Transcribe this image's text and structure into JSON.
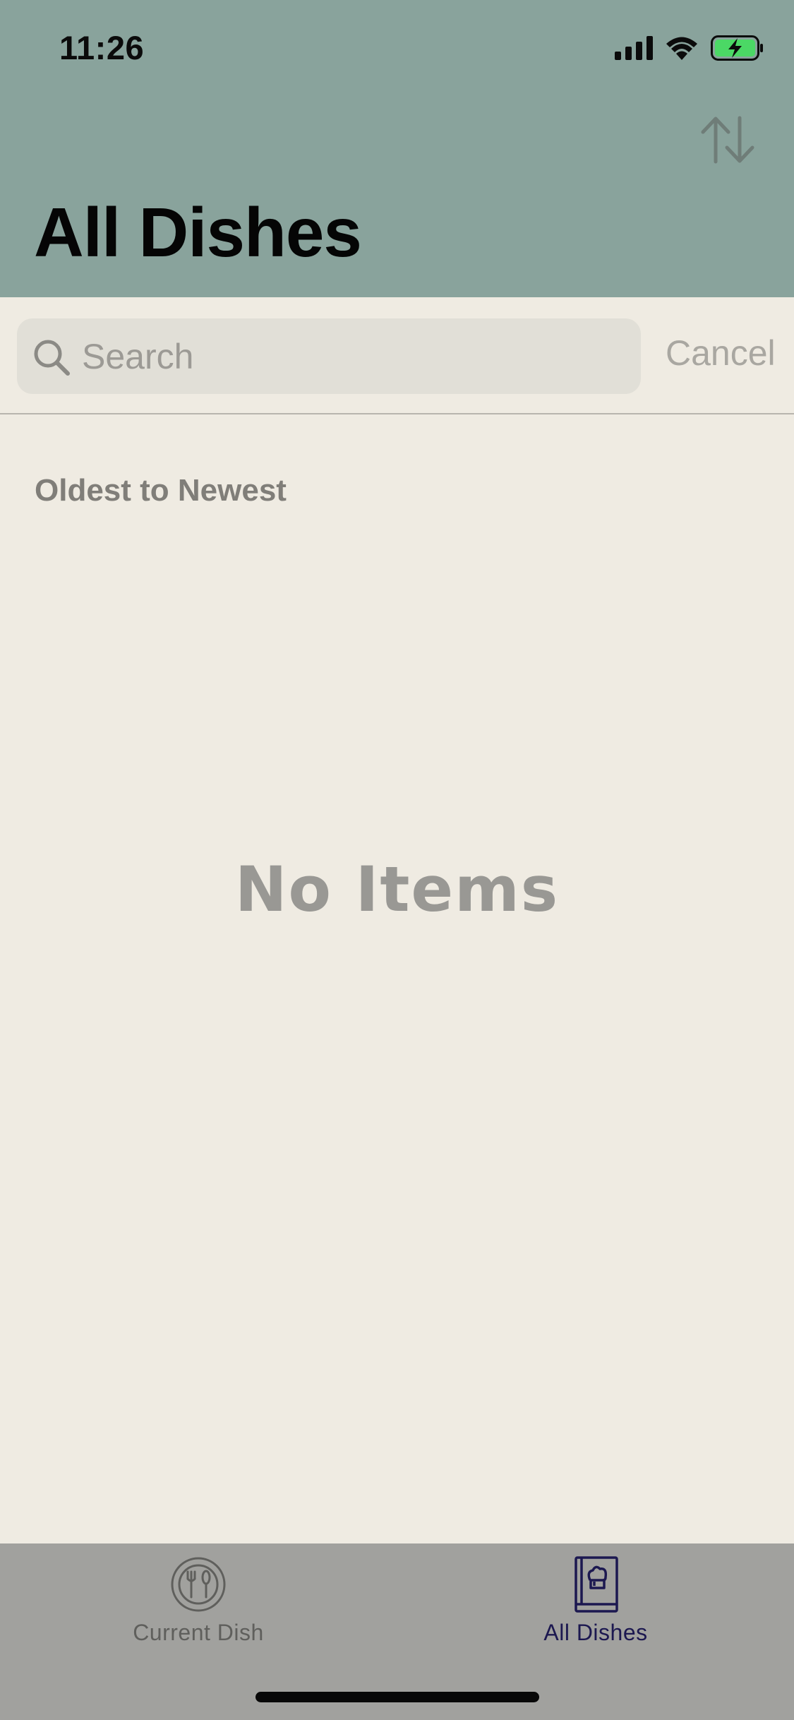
{
  "status_bar": {
    "time": "11:26",
    "icons": [
      "cellular-signal-icon",
      "wifi-icon",
      "battery-charging-icon"
    ],
    "battery_color": "#4bd865"
  },
  "header": {
    "title": "All Dishes",
    "sort_icon": "sort-arrows-icon",
    "background_color": "#89a39c"
  },
  "search": {
    "placeholder": "Search",
    "value": "",
    "cancel_label": "Cancel"
  },
  "list": {
    "sort_label": "Oldest to Newest",
    "empty_message": "No Items"
  },
  "tab_bar": {
    "tabs": [
      {
        "label": "Current Dish",
        "icon": "plate-utensils-icon",
        "selected": false
      },
      {
        "label": "All Dishes",
        "icon": "recipe-book-icon",
        "selected": true
      }
    ],
    "selected_color": "#1c1850"
  }
}
